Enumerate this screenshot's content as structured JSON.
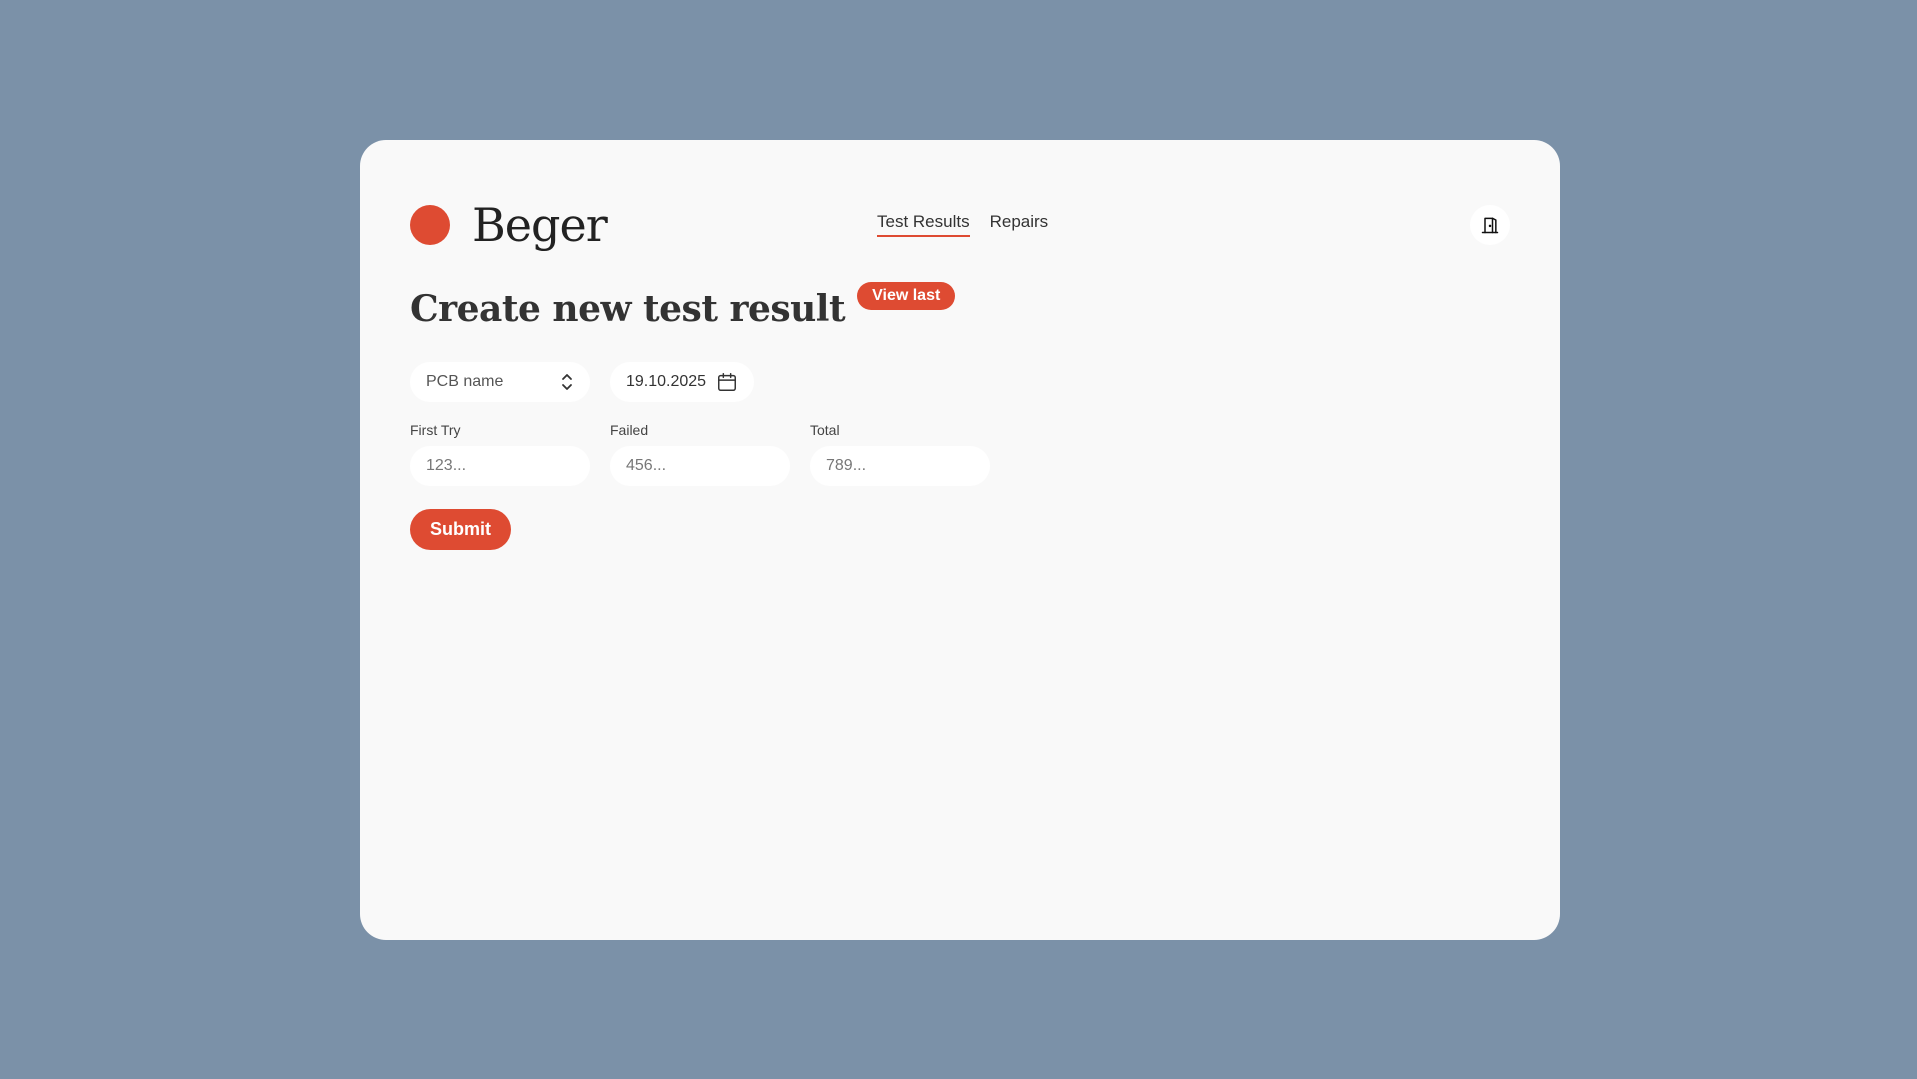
{
  "brand": {
    "name": "Beger",
    "color": "#de4b32"
  },
  "nav": {
    "items": [
      {
        "label": "Test Results",
        "active": true
      },
      {
        "label": "Repairs",
        "active": false
      }
    ]
  },
  "header": {
    "logout_icon": "door-exit-icon"
  },
  "page": {
    "title": "Create new test result",
    "view_last_label": "View last"
  },
  "form": {
    "pcb_select": {
      "placeholder": "PCB name",
      "icon": "chevron-up-down-icon"
    },
    "date": {
      "value": "19.10.2025",
      "icon": "calendar-icon"
    },
    "fields": [
      {
        "label": "First Try",
        "placeholder": "123..."
      },
      {
        "label": "Failed",
        "placeholder": "456..."
      },
      {
        "label": "Total",
        "placeholder": "789..."
      }
    ],
    "submit_label": "Submit"
  }
}
